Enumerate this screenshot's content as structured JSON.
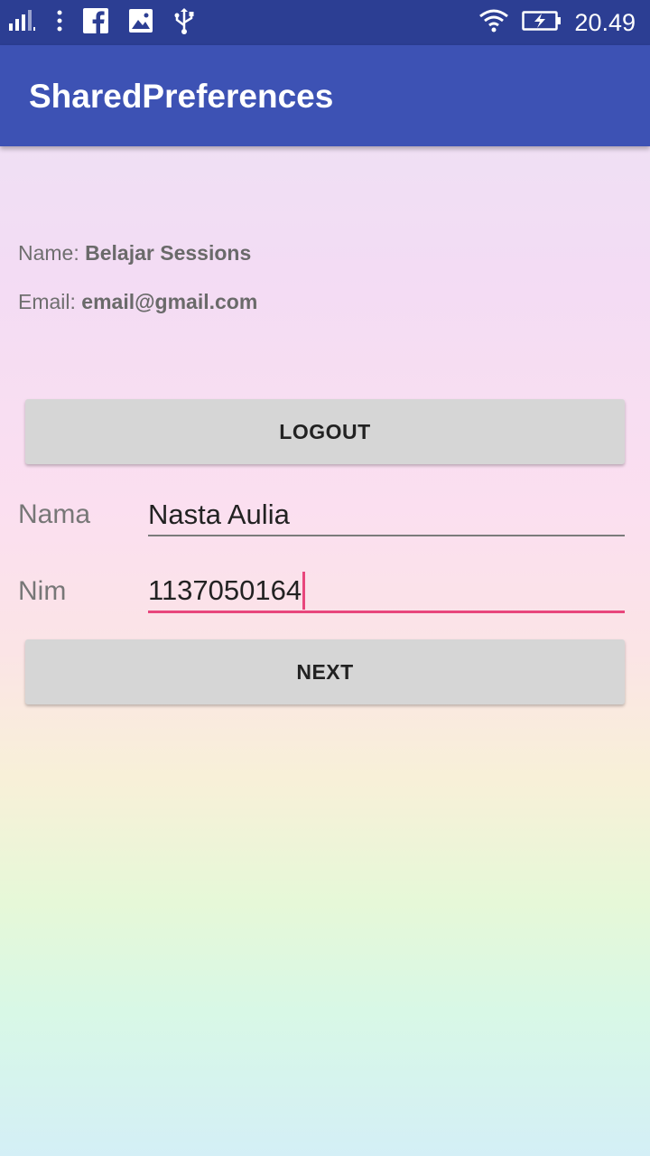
{
  "status_bar": {
    "time": "20.49",
    "icons": [
      "signal-icon",
      "more-vert-icon",
      "facebook-icon",
      "image-icon",
      "usb-icon",
      "wifi-icon",
      "battery-charging-icon"
    ]
  },
  "app_bar": {
    "title": "SharedPreferences"
  },
  "info": {
    "name_label": "Name: ",
    "name_value": "Belajar Sessions",
    "email_label": "Email: ",
    "email_value": "email@gmail.com"
  },
  "buttons": {
    "logout": "LOGOUT",
    "next": "NEXT"
  },
  "form": {
    "nama_label": "Nama",
    "nama_value": "Nasta Aulia",
    "nim_label": "Nim",
    "nim_value": "1137050164"
  },
  "colors": {
    "status_bar": "#2c3e93",
    "app_bar": "#3d52b4",
    "accent": "#e8467c",
    "button": "#d6d6d6"
  }
}
